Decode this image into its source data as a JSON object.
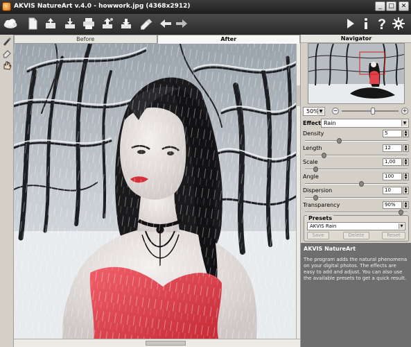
{
  "window": {
    "title": "AKVIS NatureArt v.4.0 - howwork.jpg (4368x2912)",
    "minimize_label": "_",
    "maximize_label": "□",
    "close_label": "✕"
  },
  "toolbar": {
    "left_icons": [
      "logo-cloud-icon",
      "new-document-icon",
      "open-file-icon",
      "save-file-icon",
      "print-icon",
      "upload-share-icon",
      "download-icon",
      "eraser-brush-icon",
      "undo-arrow-icon",
      "redo-arrow-icon"
    ],
    "right_icons": [
      "run-play-icon",
      "info-icon",
      "help-icon",
      "settings-gear-icon"
    ],
    "help_glyph": "?",
    "info_glyph": "i"
  },
  "left_tools": [
    "brush-icon",
    "eraser-icon",
    "hand-icon"
  ],
  "tabs": {
    "before": "Before",
    "after": "After",
    "active": "after"
  },
  "navigator": {
    "title": "Navigator",
    "zoom": "50%",
    "zoom_minus": "−",
    "zoom_plus": "+",
    "zoom_level": 0.55
  },
  "effect": {
    "label": "Effect:",
    "selected": "Rain",
    "params": [
      {
        "label": "Density",
        "value": "5",
        "level": 0.33
      },
      {
        "label": "Length",
        "value": "12",
        "level": 0.18
      },
      {
        "label": "Scale",
        "value": "1,00",
        "level": 0.1
      },
      {
        "label": "Angle",
        "value": "100",
        "level": 0.55
      },
      {
        "label": "Dispersion",
        "value": "10",
        "level": 0.1
      },
      {
        "label": "Transparency",
        "value": "90%",
        "level": 0.93
      }
    ]
  },
  "presets": {
    "title": "Presets",
    "selected": "AKVIS Rain",
    "save": "Save",
    "delete": "Delete",
    "reset": "Reset"
  },
  "help": {
    "title": "AKVIS NatureArt",
    "text": "The program adds the natural phenomena on your digital photos. The effects are easy to add and adjust. You can also use the available presets to get a quick result."
  },
  "colors": {
    "titlebar": "#2a2a2a",
    "toolbar": "#3a3a3a",
    "panel": "#d4d0c8",
    "help_bg": "#6e6e6e",
    "dress_red": "#e0434a"
  }
}
